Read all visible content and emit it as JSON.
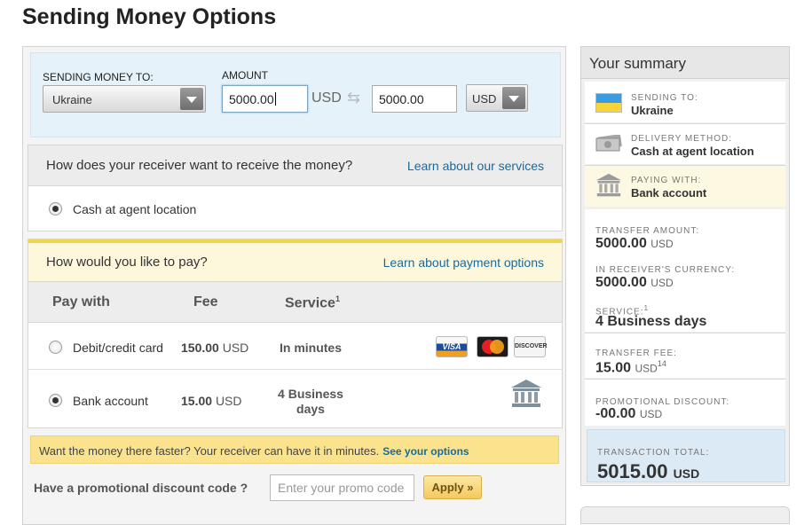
{
  "page": {
    "title": "Sending Money Options"
  },
  "sending": {
    "to_label": "SENDING MONEY TO:",
    "country": "Ukraine",
    "amount_label": "AMOUNT",
    "amount": "5000.00",
    "amount_currency": "USD",
    "receive_amount": "5000.00",
    "receive_currency": "USD"
  },
  "receive": {
    "question": "How does your receiver want to receive the money?",
    "link": "Learn about our services",
    "option": "Cash at agent location"
  },
  "pay": {
    "question": "How would you like to pay?",
    "link": "Learn about payment options",
    "headers": {
      "pay_with": "Pay with",
      "fee": "Fee",
      "service": "Service",
      "service_sup": "1"
    },
    "options": [
      {
        "name": "Debit/credit card",
        "fee": "150.00",
        "currency": "USD",
        "service": "In minutes",
        "selected": false
      },
      {
        "name": "Bank account",
        "fee": "15.00",
        "currency": "USD",
        "service_line1": "4 Business",
        "service_line2": "days",
        "selected": true
      }
    ],
    "cards": {
      "visa": "VISA",
      "mastercard": "MasterCard",
      "discover": "DISCOVER"
    }
  },
  "promo": {
    "banner_text": "Want the money there faster? Your receiver can have it in minutes.",
    "banner_link": "See your options",
    "label": "Have a promotional discount code ?",
    "placeholder": "Enter your promo code",
    "apply": "Apply »"
  },
  "summary": {
    "title": "Your summary",
    "sending_to_label": "SENDING TO:",
    "sending_to": "Ukraine",
    "delivery_label": "DELIVERY METHOD:",
    "delivery": "Cash at agent location",
    "paying_label": "PAYING WITH:",
    "paying": "Bank account",
    "transfer_amount_label": "TRANSFER AMOUNT:",
    "transfer_amount": "5000.00",
    "receiver_label": "IN RECEIVER'S CURRENCY:",
    "receiver_amount": "5000.00",
    "service_label": "SERVICE:",
    "service_sup": "1",
    "service": "4 Business days",
    "fee_label": "TRANSFER FEE:",
    "fee": "15.00",
    "fee_sup": "14",
    "discount_label": "PROMOTIONAL DISCOUNT:",
    "discount": "-00.00",
    "total_label": "TRANSACTION TOTAL:",
    "total": "5015.00",
    "currency": "USD"
  },
  "colors": {
    "accent_blue": "#1a6a9c",
    "banner_yellow": "#fbe38e",
    "summary_total_bg": "#dbeaf4"
  }
}
